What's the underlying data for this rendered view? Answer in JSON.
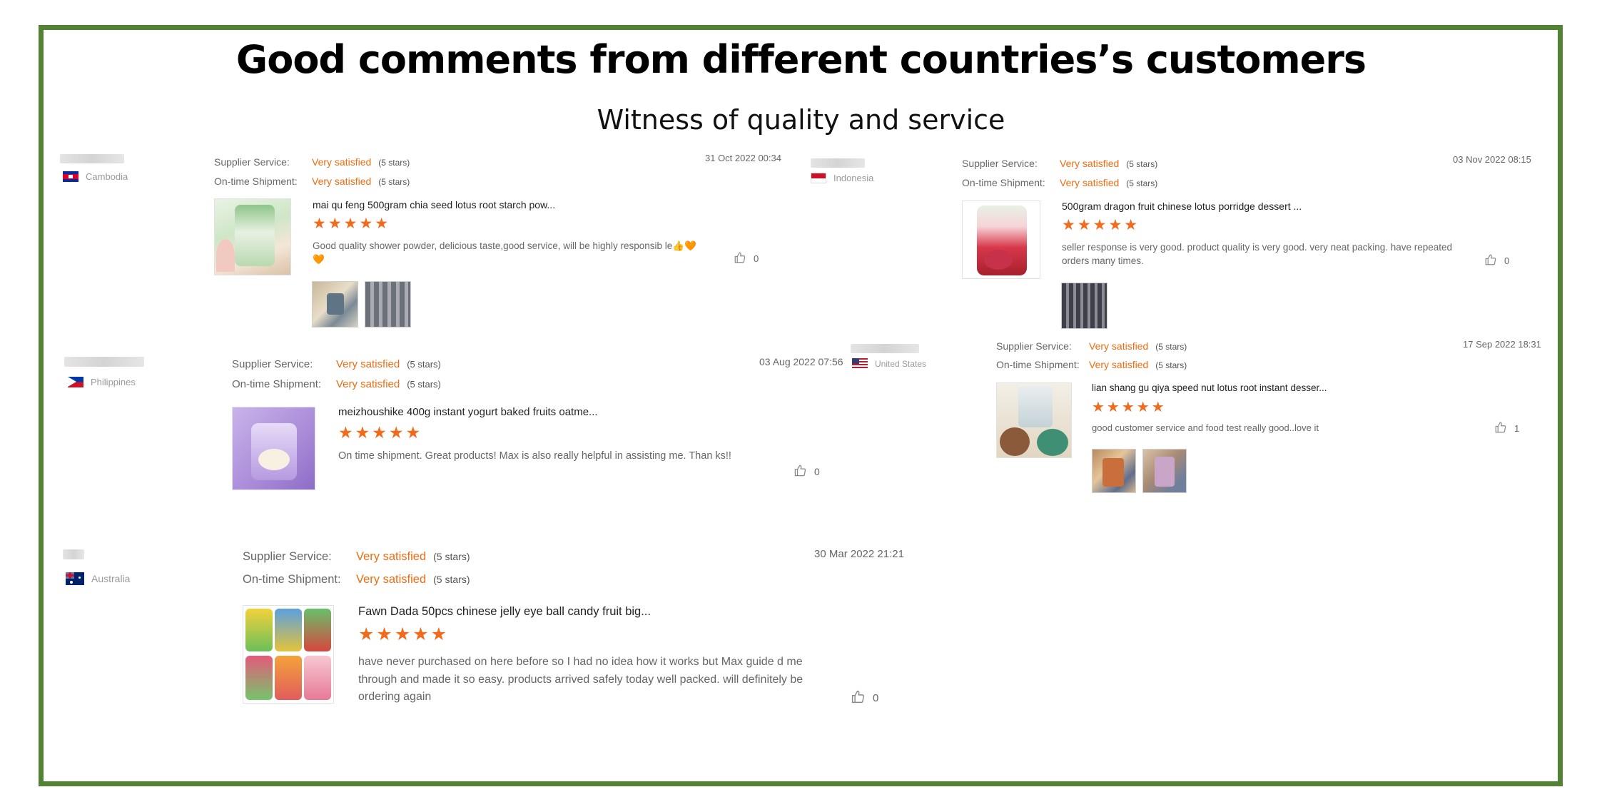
{
  "title": "Good comments from different countries’s customers",
  "subtitle": "Witness of quality and service",
  "labels": {
    "supplier_service": "Supplier Service:",
    "ontime_shipment": "On-time Shipment:",
    "ontime_shipment_nocolon": "On-time Shipment",
    "very_satisfied": "Very satisfied",
    "five_stars": "(5 stars)",
    "star_row": "★★★★★"
  },
  "reviews": [
    {
      "country": "Cambodia",
      "date": "31 Oct 2022 00:34",
      "product_title": "mai qu feng 500gram chia seed lotus root starch pow...",
      "comment": "Good quality shower powder, delicious taste,good service, will be highly responsib le👍🧡🧡",
      "likes": "0",
      "rating_stars": 5,
      "photo_count": 2
    },
    {
      "country": "Indonesia",
      "date": "03 Nov 2022 08:15",
      "product_title": "500gram dragon fruit chinese lotus porridge dessert ...",
      "comment": "seller response is very good. product quality is very good. very neat packing. have repeated orders many times.",
      "likes": "0",
      "rating_stars": 5,
      "photo_count": 1
    },
    {
      "country": "Philippines",
      "date": "03 Aug 2022 07:56",
      "product_title": "meizhoushike 400g instant yogurt baked fruits oatme...",
      "comment": "On time shipment. Great products! Max is also really helpful in assisting me. Than ks!!",
      "likes": "0",
      "rating_stars": 5,
      "photo_count": 0
    },
    {
      "country": "United States",
      "date": "17 Sep 2022 18:31",
      "product_title": "lian shang gu qiya speed nut lotus root instant desser...",
      "comment": "good customer service and food test really good..love it",
      "likes": "1",
      "rating_stars": 5,
      "photo_count": 2
    },
    {
      "country": "Australia",
      "date": "30 Mar 2022 21:21",
      "product_title": "Fawn Dada 50pcs chinese jelly eye ball candy fruit big...",
      "comment": "have never purchased on here before so I had no idea how it works but Max guide d me through and made it so easy. products arrived safely today well packed. will definitely be ordering again",
      "likes": "0",
      "rating_stars": 5,
      "photo_count": 0
    }
  ],
  "colors": {
    "frame_border": "#548235",
    "satisfied_orange": "#ef6c12",
    "star_orange": "#f26a1b"
  },
  "icons": [
    "thumbs-up-icon",
    "flag-icon"
  ]
}
